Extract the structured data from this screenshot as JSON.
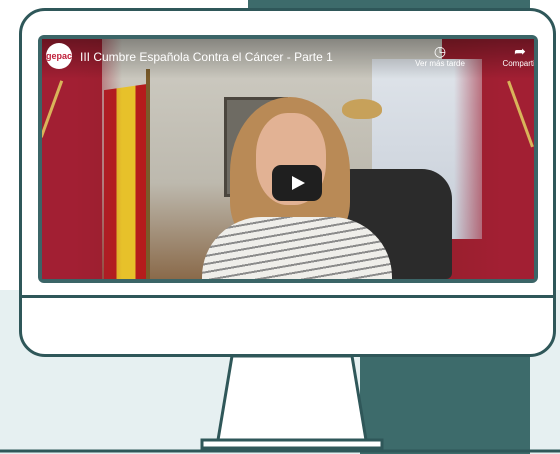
{
  "video": {
    "channel_logo_text": "gepac",
    "title": "III Cumbre Española Contra el Cáncer - Parte 1",
    "watch_later_label": "Ver más tarde",
    "share_label": "Compartir"
  },
  "colors": {
    "teal": "#3d6b6b",
    "light_blue": "#e6f0f1",
    "video_red": "#a21f33"
  }
}
